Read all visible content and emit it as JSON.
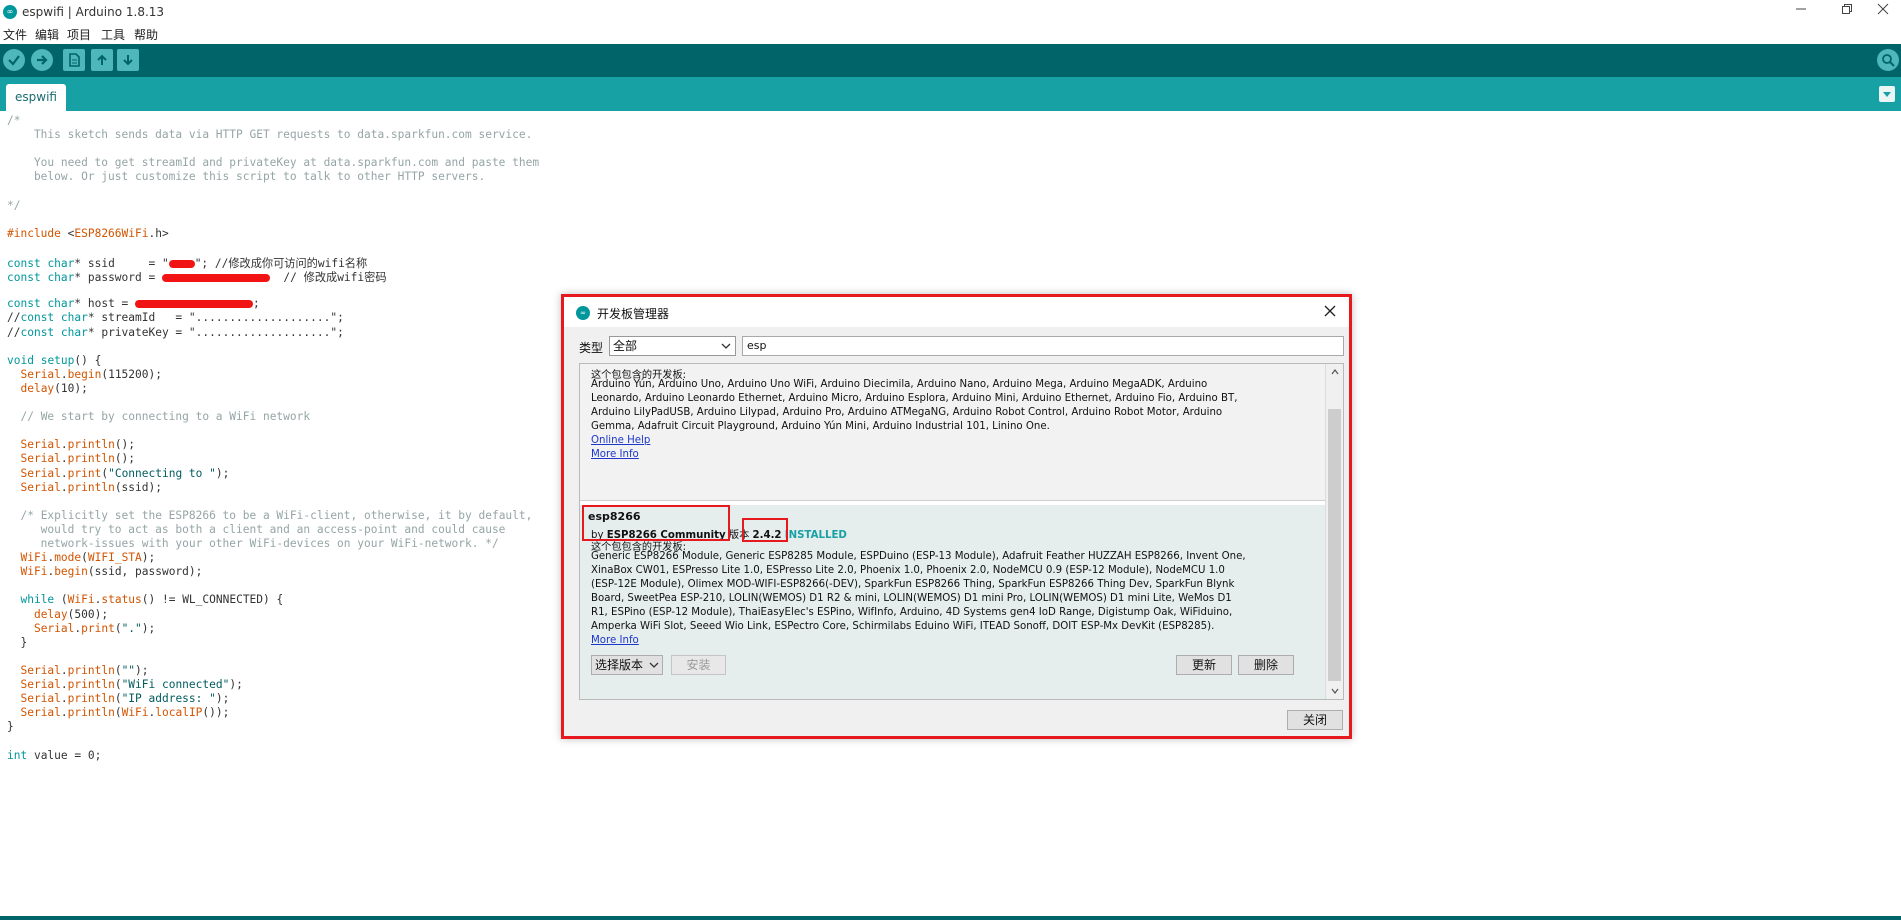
{
  "window": {
    "title": "espwifi | Arduino 1.8.13",
    "app_logo": "∞"
  },
  "menubar": [
    "文件",
    "编辑",
    "项目",
    "工具",
    "帮助"
  ],
  "toolbar": {
    "buttons": [
      "verify-icon",
      "upload-icon",
      "new-icon",
      "open-icon",
      "save-icon",
      "serial-monitor-icon"
    ]
  },
  "tabs": [
    {
      "label": "espwifi"
    }
  ],
  "editor": {
    "lines": [
      {
        "y": 0,
        "html": "<span class='c-cmt'>/*</span>"
      },
      {
        "y": 1,
        "html": "<span class='c-cmt'>    This sketch sends data via HTTP GET requests to data.sparkfun.com service.</span>"
      },
      {
        "y": 3,
        "html": "<span class='c-cmt'>    You need to get streamId and privateKey at data.sparkfun.com and paste them</span>"
      },
      {
        "y": 4,
        "html": "<span class='c-cmt'>    below. Or just customize this script to talk to other HTTP servers.</span>"
      },
      {
        "y": 6,
        "html": "<span class='c-cmt'>*/</span>"
      },
      {
        "y": 8,
        "html": "<span class='c-fn'>#include</span> &lt;<span class='c-fn'>ESP8266WiFi</span>.h&gt;"
      },
      {
        "y": 10,
        "html": "<span class='c-ty'>const</span> <span class='c-ty'>char</span>* ssid     = \"<span class='redact' style='width:26px'></span>\"; //修改成你可访问的wifi名称"
      },
      {
        "y": 11,
        "html": "<span class='c-ty'>const</span> <span class='c-ty'>char</span>* password = <span class='redact' style='width:108px'></span>  // 修改成wifi密码"
      },
      {
        "y": 13,
        "html": "<span class='c-ty'>const</span> <span class='c-ty'>char</span>* host = <span class='redact' style='width:118px'></span>;"
      },
      {
        "y": 14,
        "html": "//<span class='c-ty'>const</span> <span class='c-ty'>char</span>* streamId   = \"....................\";"
      },
      {
        "y": 15,
        "html": "//<span class='c-ty'>const</span> <span class='c-ty'>char</span>* privateKey = \"....................\";"
      },
      {
        "y": 17,
        "html": "<span class='c-ty'>void</span> <span class='c-kw'>setup</span>() {"
      },
      {
        "y": 18,
        "html": "  <span class='c-fn'>Serial</span>.<span class='c-fn'>begin</span>(115200);"
      },
      {
        "y": 19,
        "html": "  <span class='c-fn'>delay</span>(10);"
      },
      {
        "y": 21,
        "html": "  <span class='c-cmt'>// We start by connecting to a WiFi network</span>"
      },
      {
        "y": 23,
        "html": "  <span class='c-fn'>Serial</span>.<span class='c-fn'>println</span>();"
      },
      {
        "y": 24,
        "html": "  <span class='c-fn'>Serial</span>.<span class='c-fn'>println</span>();"
      },
      {
        "y": 25,
        "html": "  <span class='c-fn'>Serial</span>.<span class='c-fn'>print</span>(<span class='c-str'>\"Connecting to \"</span>);"
      },
      {
        "y": 26,
        "html": "  <span class='c-fn'>Serial</span>.<span class='c-fn'>println</span>(ssid);"
      },
      {
        "y": 28,
        "html": "  <span class='c-cmt'>/* Explicitly set the ESP8266 to be a WiFi-client, otherwise, it by default,</span>"
      },
      {
        "y": 29,
        "html": "<span class='c-cmt'>     would try to act as both a client and an access-point and could cause</span>"
      },
      {
        "y": 30,
        "html": "<span class='c-cmt'>     network-issues with your other WiFi-devices on your WiFi-network. */</span>"
      },
      {
        "y": 31,
        "html": "  <span class='c-fn'>WiFi</span>.<span class='c-fn'>mode</span>(<span class='c-fn'>WIFI_STA</span>);"
      },
      {
        "y": 32,
        "html": "  <span class='c-fn'>WiFi</span>.<span class='c-fn'>begin</span>(ssid, password);"
      },
      {
        "y": 34,
        "html": "  <span class='c-kw'>while</span> (<span class='c-fn'>WiFi</span>.<span class='c-fn'>status</span>() != WL_CONNECTED) {"
      },
      {
        "y": 35,
        "html": "    <span class='c-fn'>delay</span>(500);"
      },
      {
        "y": 36,
        "html": "    <span class='c-fn'>Serial</span>.<span class='c-fn'>print</span>(<span class='c-str'>\".\"</span>);"
      },
      {
        "y": 37,
        "html": "  }"
      },
      {
        "y": 39,
        "html": "  <span class='c-fn'>Serial</span>.<span class='c-fn'>println</span>(<span class='c-str'>\"\"</span>);"
      },
      {
        "y": 40,
        "html": "  <span class='c-fn'>Serial</span>.<span class='c-fn'>println</span>(<span class='c-str'>\"WiFi connected\"</span>);"
      },
      {
        "y": 41,
        "html": "  <span class='c-fn'>Serial</span>.<span class='c-fn'>println</span>(<span class='c-str'>\"IP address: \"</span>);"
      },
      {
        "y": 42,
        "html": "  <span class='c-fn'>Serial</span>.<span class='c-fn'>println</span>(<span class='c-fn'>WiFi</span>.<span class='c-fn'>localIP</span>());"
      },
      {
        "y": 43,
        "html": "}"
      },
      {
        "y": 45,
        "html": "<span class='c-ty'>int</span> value = 0;"
      }
    ]
  },
  "dialog": {
    "title": "开发板管理器",
    "filter_label": "类型",
    "type_value": "全部",
    "search_value": "esp",
    "packages": [
      {
        "boards_label": "这个包包含的开发板:",
        "boards_lines": [
          "Arduino Yún, Arduino Uno, Arduino Uno WiFi, Arduino Diecimila, Arduino Nano, Arduino Mega, Arduino MegaADK, Arduino",
          "Leonardo, Arduino Leonardo Ethernet, Arduino Micro, Arduino Esplora, Arduino Mini, Arduino Ethernet, Arduino Fio, Arduino BT,",
          "Arduino LilyPadUSB, Arduino Lilypad, Arduino Pro, Arduino ATMegaNG, Arduino Robot Control, Arduino Robot Motor, Arduino",
          "Gemma, Adafruit Circuit Playground, Arduino Yún Mini, Arduino Industrial 101, Linino One."
        ],
        "online_help": "Online Help",
        "more_info": "More Info"
      },
      {
        "name": "esp8266",
        "by": "by",
        "author": "ESP8266 Community",
        "version_label": "版本",
        "version": "2.4.2",
        "installed": "INSTALLED",
        "boards_label": "这个包包含的开发板:",
        "boards_lines": [
          "Generic ESP8266 Module, Generic ESP8285 Module, ESPDuino (ESP-13 Module), Adafruit Feather HUZZAH ESP8266, Invent One,",
          "XinaBox CW01, ESPresso Lite 1.0, ESPresso Lite 2.0, Phoenix 1.0, Phoenix 2.0, NodeMCU 0.9 (ESP-12 Module), NodeMCU 1.0",
          "(ESP-12E Module), Olimex MOD-WIFI-ESP8266(-DEV), SparkFun ESP8266 Thing, SparkFun ESP8266 Thing Dev, SparkFun Blynk",
          "Board, SweetPea ESP-210, LOLIN(WEMOS) D1 R2 & mini, LOLIN(WEMOS) D1 mini Pro, LOLIN(WEMOS) D1 mini Lite, WeMos D1",
          "R1, ESPino (ESP-12 Module), ThaiEasyElec's ESPino, WifInfo, Arduino, 4D Systems gen4 IoD Range, Digistump Oak, WiFiduino,",
          "Amperka WiFi Slot, Seeed Wio Link, ESPectro Core, Schirmilabs Eduino WiFi, ITEAD Sonoff, DOIT ESP-Mx DevKit (ESP8285)."
        ],
        "more_info": "More Info",
        "select_version": "选择版本",
        "install": "安装",
        "update": "更新",
        "remove": "删除"
      }
    ],
    "close_button": "关闭"
  }
}
